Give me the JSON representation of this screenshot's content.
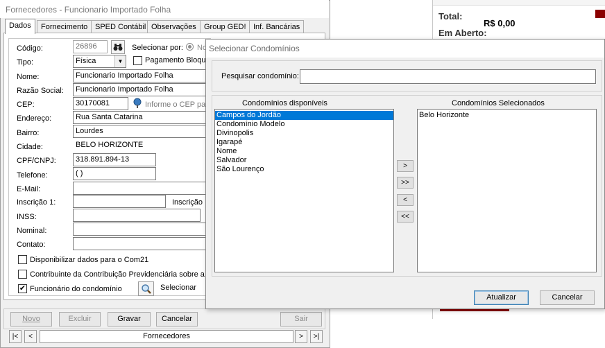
{
  "form": {
    "title": "Fornecedores - Funcionario Importado Folha",
    "tabs": [
      "Dados",
      "Fornecimento",
      "SPED Contábil",
      "Observações",
      "Group GED!",
      "Inf. Bancárias"
    ],
    "labels": {
      "codigo": "Código:",
      "tipo": "Tipo:",
      "nome": "Nome:",
      "razao_social": "Razão Social:",
      "cep": "CEP:",
      "endereco": "Endereço:",
      "bairro": "Bairro:",
      "cidade": "Cidade:",
      "cpf_cnpj": "CPF/CNPJ:",
      "telefone": "Telefone:",
      "email": "E-Mail:",
      "inscricao1": "Inscrição 1:",
      "inscricao2": "Inscrição",
      "inss": "INSS:",
      "nominal": "Nominal:",
      "contato": "Contato:"
    },
    "values": {
      "codigo": "26896",
      "tipo": "Física",
      "nome": "Funcionario Importado Folha",
      "razao_social": "Funcionario Importado Folha",
      "cep": "30170081",
      "endereco": "Rua Santa Catarina",
      "bairro": "Lourdes",
      "cidade": "BELO HORIZONTE",
      "cpf_cnpj": "318.891.894-13",
      "telefone": "( )",
      "email": "",
      "inscricao1": "",
      "inss": "",
      "nominal": "",
      "contato": ""
    },
    "selecionar_por_label": "Selecionar por:",
    "selecionar_por_option": "No",
    "pagamento_label": "Pagamento Bloque",
    "cep_hint": "Informe o CEP par",
    "checkboxes": {
      "disponibilizar": {
        "label": "Disponibilizar dados para o Com21",
        "checked": false
      },
      "contribuinte": {
        "label": "Contribuinte da Contribuição Previdenciária sobre a F",
        "checked": false
      },
      "funcionario": {
        "label": "Funcionário do condomínio",
        "checked": true
      }
    },
    "selecionar_button": "Selecionar",
    "buttons": {
      "novo": "Novo",
      "excluir": "Excluir",
      "gravar": "Gravar",
      "cancelar": "Cancelar",
      "sair": "Sair"
    },
    "nav": {
      "first": "|<",
      "prev": "<",
      "label": "Fornecedores",
      "next": ">",
      "last": ">|"
    }
  },
  "right_panel": {
    "total_label": "Total:",
    "total_value": "R$ 0,00",
    "em_aberto_label": "Em Aberto:"
  },
  "dialog": {
    "title": "Selecionar Condomínios",
    "search_label": "Pesquisar condomínio:",
    "search_value": "",
    "available_header": "Condomínios disponíveis",
    "selected_header": "Condomínios Selecionados",
    "available": [
      "Campos do Jordão",
      "Condomínio Modelo",
      "Divinopolis",
      "Igarapé",
      "Nome",
      "Salvador",
      "São Lourenço"
    ],
    "available_selected_index": 0,
    "selected": [
      "Belo Horizonte"
    ],
    "move_buttons": {
      "add": ">",
      "add_all": ">>",
      "remove": "<",
      "remove_all": "<<"
    },
    "atualizar": "Atualizar",
    "cancelar": "Cancelar"
  }
}
